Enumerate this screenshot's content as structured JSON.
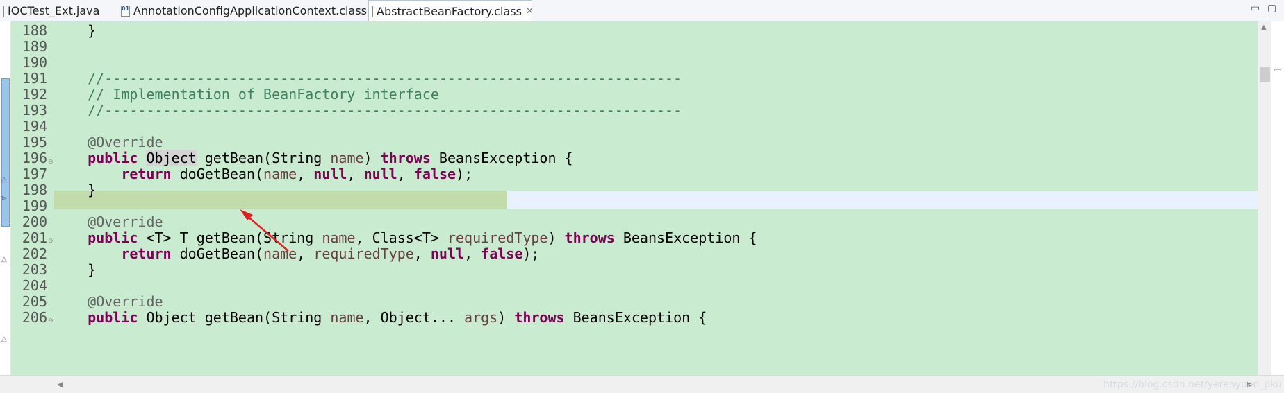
{
  "tabs": [
    {
      "label": "IOCTest_Ext.java",
      "icon": "java-file-icon",
      "active": false
    },
    {
      "label": "AnnotationConfigApplicationContext.class",
      "icon": "class-file-icon",
      "active": false
    },
    {
      "label": "AbstractBeanFactory.class",
      "icon": "class-file-icon",
      "active": true
    }
  ],
  "window_controls": {
    "minimize": "▭",
    "maximize": "▢"
  },
  "editor": {
    "line_numbers": [
      "188",
      "189",
      "190",
      "191",
      "192",
      "193",
      "194",
      "195",
      "196",
      "197",
      "198",
      "199",
      "200",
      "201",
      "202",
      "203",
      "204",
      "205",
      "206"
    ],
    "current_line": "197",
    "code": {
      "l188": "    }",
      "l191": "    //---------------------------------------------------------------------",
      "l192": "    // Implementation of BeanFactory interface",
      "l193": "    //---------------------------------------------------------------------",
      "l195": "    @Override",
      "l196": {
        "t0": "    ",
        "k0": "public",
        "t1": " ",
        "occ": "Object",
        "t2": " getBean(String ",
        "p0": "name",
        "t3": ") ",
        "k1": "throws",
        "t4": " BeansException {"
      },
      "l197": {
        "t0": "        ",
        "k0": "return",
        "t1": " doGetBean(",
        "p0": "name",
        "t2": ", ",
        "k1": "null",
        "t3": ", ",
        "k2": "null",
        "t4": ", ",
        "k3": "false",
        "t5": ");"
      },
      "l198": "    }",
      "l200": "    @Override",
      "l201": {
        "t0": "    ",
        "k0": "public",
        "t1": " <T> T getBean(String ",
        "p0": "name",
        "t2": ", Class<T> ",
        "p1": "requiredType",
        "t3": ") ",
        "k1": "throws",
        "t4": " BeansException {"
      },
      "l202": {
        "t0": "        ",
        "k0": "return",
        "t1": " doGetBean(",
        "p0": "name",
        "t2": ", ",
        "p1": "requiredType",
        "t3": ", ",
        "k1": "null",
        "t4": ", ",
        "k2": "false",
        "t5": ");"
      },
      "l203": "    }",
      "l205": "    @Override",
      "l206": {
        "t0": "    ",
        "k0": "public",
        "t1": " Object getBean(String ",
        "p0": "name",
        "t2": ", Object... ",
        "p1": "args",
        "t3": ") ",
        "k1": "throws",
        "t4": " BeansException {"
      }
    }
  },
  "watermark": "https://blog.csdn.net/yerenyuan_pku",
  "colors": {
    "editor_bg": "#c9ecd1",
    "keyword": "#7f0055",
    "comment": "#3f7f5f",
    "annotation": "#646464",
    "parameter": "#6a3e3e",
    "current_line": "#e8f2fe",
    "arrow": "#e02020"
  }
}
